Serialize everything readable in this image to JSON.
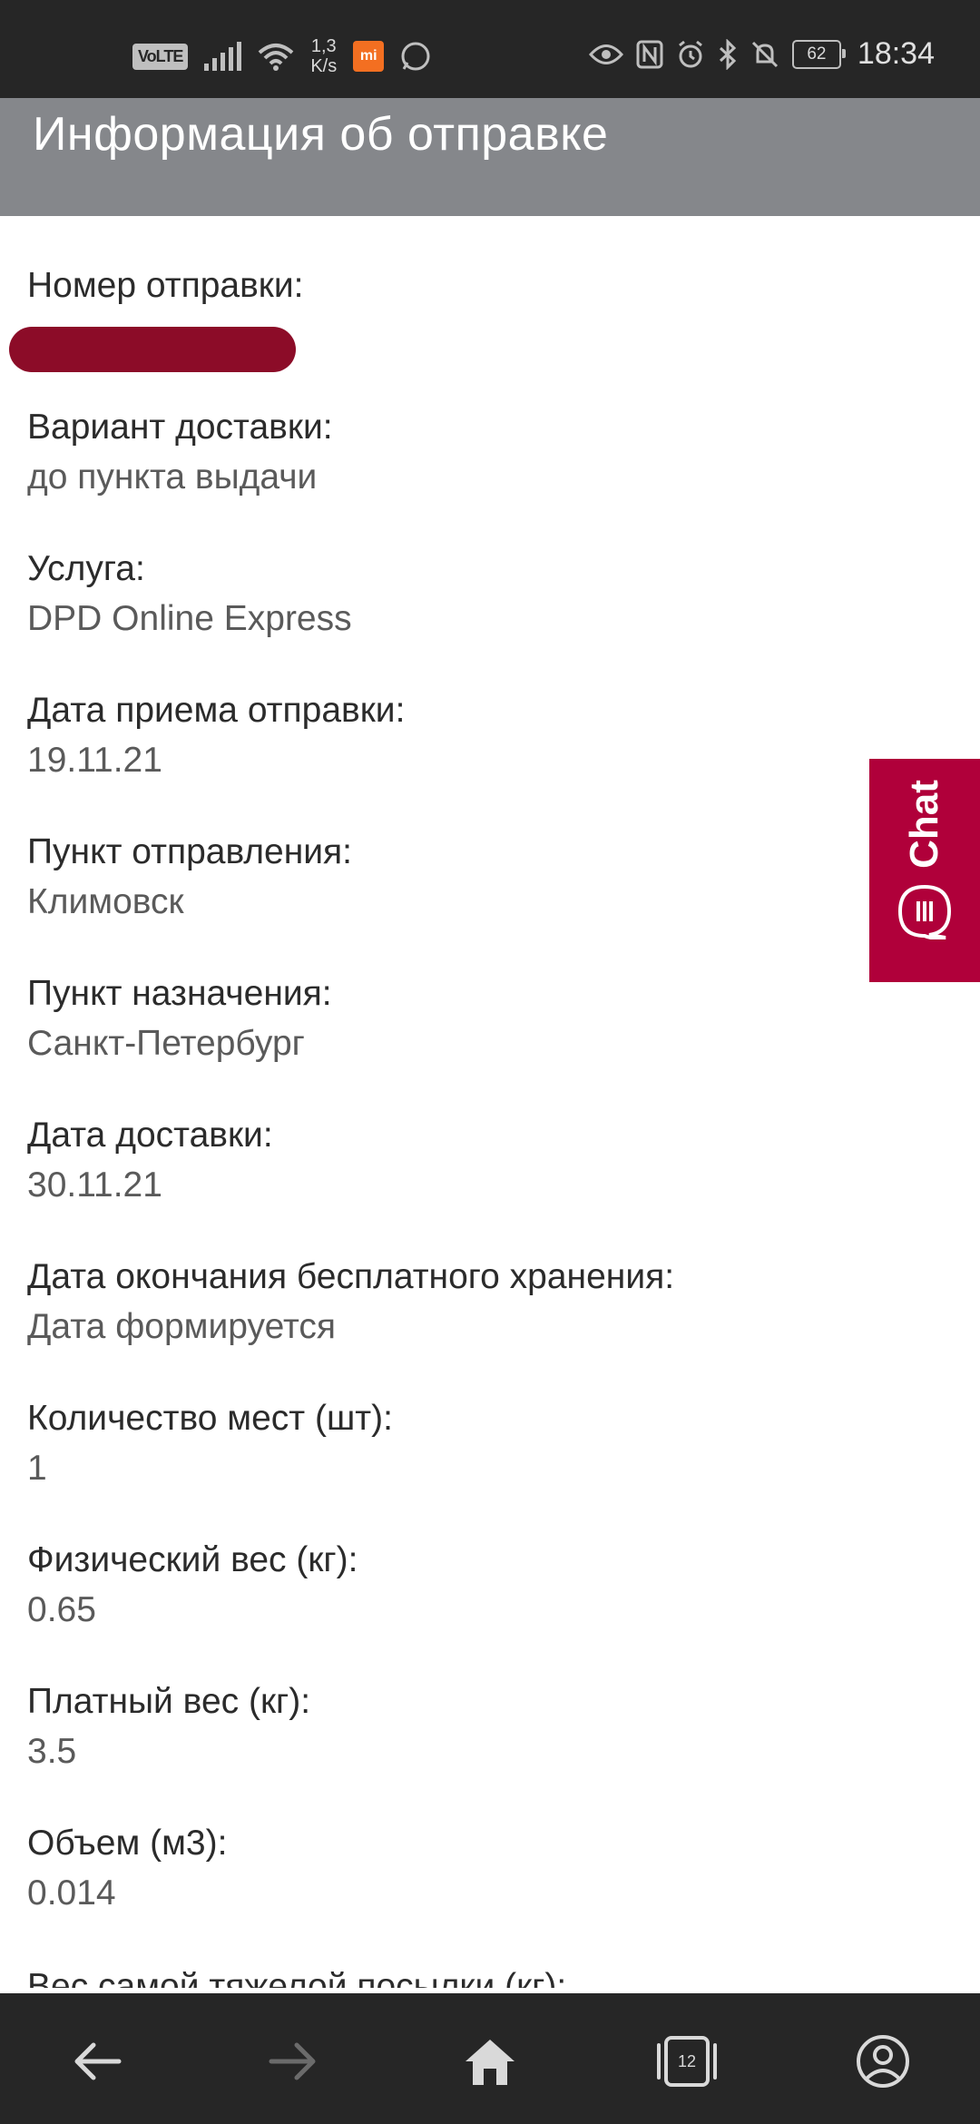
{
  "status_bar": {
    "volte": "VoLTE",
    "net_speed_value": "1,3",
    "net_speed_unit": "K/s",
    "mi_badge": "mi",
    "battery": "62",
    "time": "18:34"
  },
  "header": {
    "title": "Информация об отправке"
  },
  "fields": [
    {
      "label": "Номер отправки:",
      "value": ""
    },
    {
      "label": "Вариант доставки:",
      "value": "до пункта выдачи"
    },
    {
      "label": "Услуга:",
      "value": "DPD Online Express"
    },
    {
      "label": "Дата приема отправки:",
      "value": "19.11.21"
    },
    {
      "label": "Пункт отправления:",
      "value": "Климовск"
    },
    {
      "label": "Пункт назначения:",
      "value": "Санкт-Петербург"
    },
    {
      "label": "Дата доставки:",
      "value": "30.11.21"
    },
    {
      "label": "Дата окончания бесплатного хранения:",
      "value": "Дата формируется"
    },
    {
      "label": "Количество мест (шт):",
      "value": "1"
    },
    {
      "label": "Физический вес (кг):",
      "value": "0.65"
    },
    {
      "label": "Платный вес (кг):",
      "value": "3.5"
    },
    {
      "label": "Объем (м3):",
      "value": "0.014"
    }
  ],
  "partial_label": "Вес самой тяжелой посылки (кг):",
  "chat": {
    "label": "Chat"
  },
  "browser_nav": {
    "tabs_count": "12"
  },
  "colors": {
    "header_bg": "#85878b",
    "chat_bg": "#b0003a",
    "redaction": "#8c0c28"
  }
}
